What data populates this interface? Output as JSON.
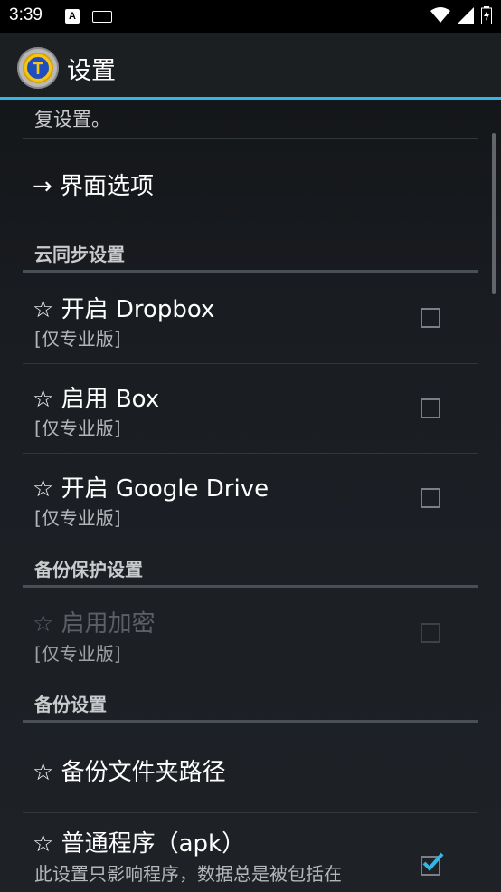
{
  "status_bar": {
    "time": "3:39",
    "a_label": "A"
  },
  "app_bar": {
    "title": "设置",
    "logo_letter": "T"
  },
  "list": {
    "partial_top_text": "复设置。",
    "interface_options": "→ 界面选项",
    "cloud_sync_header": "云同步设置",
    "cloud_items": [
      {
        "title": "☆ 开启 Dropbox",
        "subtitle": "[仅专业版]",
        "checked": false
      },
      {
        "title": "☆ 启用 Box",
        "subtitle": "[仅专业版]",
        "checked": false
      },
      {
        "title": "☆ 开启 Google Drive",
        "subtitle": "[仅专业版]",
        "checked": false
      }
    ],
    "backup_protection_header": "备份保护设置",
    "encryption": {
      "title": "☆ 启用加密",
      "subtitle": "[仅专业版]",
      "checked": false,
      "enabled": false
    },
    "backup_header": "备份设置",
    "backup_folder": "☆ 备份文件夹路径",
    "apk_item": {
      "title": "☆ 普通程序（apk）",
      "subtitle": "此设置只影响程序，数据总是被包括在",
      "checked": true
    }
  },
  "colors": {
    "accent": "#33b5e5"
  }
}
